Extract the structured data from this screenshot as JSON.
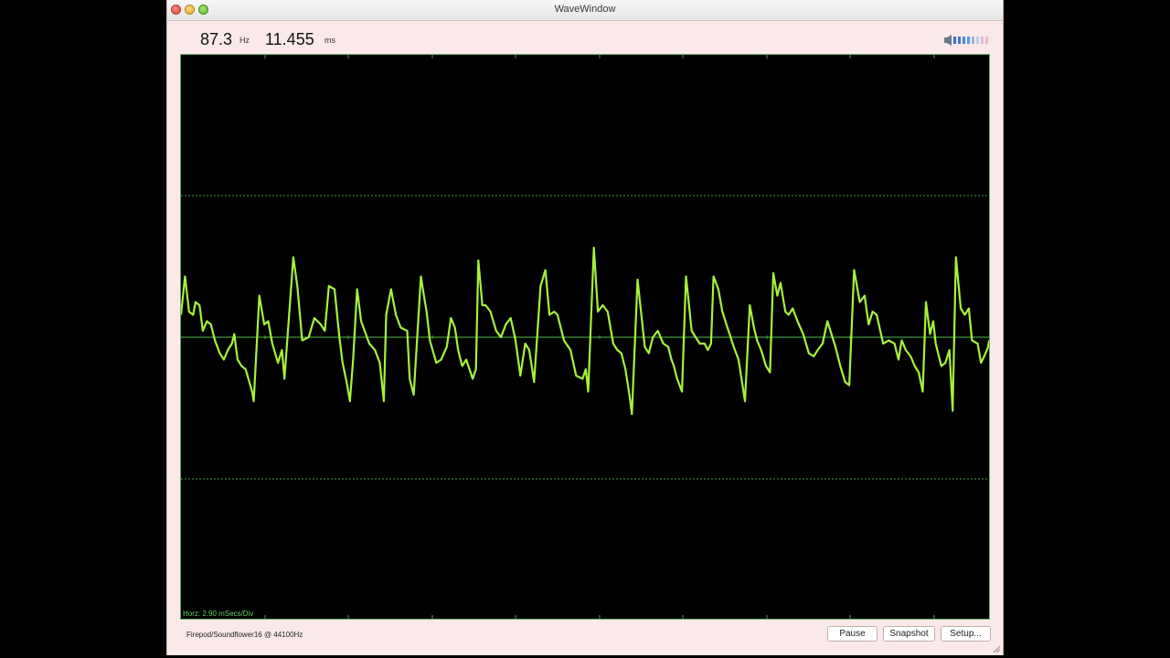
{
  "window": {
    "title": "WaveWindow"
  },
  "readout": {
    "frequency_value": "87.3",
    "frequency_unit": "Hz",
    "period_value": "11.455",
    "period_unit": "ms"
  },
  "scope": {
    "horizontal_scale": "Horz: 2.90 mSecs/Div",
    "trace_color": "#a6f23c",
    "grid_color": "#4f9a4f",
    "background_color": "#000000"
  },
  "status": {
    "device": "Firepod/Soundflower16 @ 44100Hz"
  },
  "buttons": {
    "pause": "Pause",
    "snapshot": "Snapshot",
    "setup": "Setup..."
  },
  "waveform": [
    [
      0.0,
      -0.35
    ],
    [
      0.005,
      -0.95
    ],
    [
      0.01,
      -0.4
    ],
    [
      0.015,
      -0.35
    ],
    [
      0.018,
      -0.55
    ],
    [
      0.023,
      -0.5
    ],
    [
      0.027,
      -0.1
    ],
    [
      0.032,
      -0.25
    ],
    [
      0.037,
      -0.2
    ],
    [
      0.042,
      0.05
    ],
    [
      0.048,
      0.25
    ],
    [
      0.053,
      0.35
    ],
    [
      0.058,
      0.2
    ],
    [
      0.063,
      0.1
    ],
    [
      0.066,
      -0.05
    ],
    [
      0.07,
      0.35
    ],
    [
      0.075,
      0.45
    ],
    [
      0.08,
      0.5
    ],
    [
      0.088,
      0.85
    ],
    [
      0.09,
      1.0
    ],
    [
      0.097,
      -0.65
    ],
    [
      0.103,
      -0.2
    ],
    [
      0.108,
      -0.25
    ],
    [
      0.113,
      0.1
    ],
    [
      0.12,
      0.4
    ],
    [
      0.125,
      0.2
    ],
    [
      0.128,
      0.65
    ],
    [
      0.139,
      -1.25
    ],
    [
      0.144,
      -0.8
    ],
    [
      0.15,
      0.05
    ],
    [
      0.158,
      0.0
    ],
    [
      0.165,
      -0.3
    ],
    [
      0.173,
      -0.2
    ],
    [
      0.178,
      -0.1
    ],
    [
      0.183,
      -0.8
    ],
    [
      0.19,
      -0.75
    ],
    [
      0.196,
      0.0
    ],
    [
      0.2,
      0.4
    ],
    [
      0.205,
      0.7
    ],
    [
      0.209,
      1.0
    ],
    [
      0.213,
      0.35
    ],
    [
      0.218,
      -0.75
    ],
    [
      0.223,
      -0.25
    ],
    [
      0.233,
      0.1
    ],
    [
      0.24,
      0.2
    ],
    [
      0.246,
      0.4
    ],
    [
      0.251,
      1.0
    ],
    [
      0.254,
      -0.35
    ],
    [
      0.26,
      -0.75
    ],
    [
      0.266,
      -0.35
    ],
    [
      0.272,
      -0.15
    ],
    [
      0.28,
      -0.1
    ],
    [
      0.283,
      0.65
    ],
    [
      0.288,
      0.9
    ],
    [
      0.297,
      -0.95
    ],
    [
      0.3,
      -0.7
    ],
    [
      0.304,
      -0.4
    ],
    [
      0.308,
      0.05
    ],
    [
      0.316,
      0.4
    ],
    [
      0.322,
      0.35
    ],
    [
      0.329,
      0.15
    ],
    [
      0.334,
      -0.3
    ],
    [
      0.339,
      -0.15
    ],
    [
      0.343,
      0.2
    ],
    [
      0.348,
      0.45
    ],
    [
      0.353,
      0.35
    ],
    [
      0.361,
      0.65
    ],
    [
      0.365,
      0.5
    ],
    [
      0.368,
      -1.2
    ],
    [
      0.373,
      -0.5
    ],
    [
      0.377,
      -0.5
    ],
    [
      0.383,
      -0.4
    ],
    [
      0.39,
      -0.1
    ],
    [
      0.396,
      0.0
    ],
    [
      0.402,
      -0.2
    ],
    [
      0.408,
      -0.3
    ],
    [
      0.414,
      0.05
    ],
    [
      0.42,
      0.6
    ],
    [
      0.426,
      0.1
    ],
    [
      0.431,
      0.2
    ],
    [
      0.437,
      0.7
    ],
    [
      0.445,
      -0.8
    ],
    [
      0.451,
      -1.05
    ],
    [
      0.456,
      -0.35
    ],
    [
      0.462,
      -0.4
    ],
    [
      0.466,
      -0.35
    ],
    [
      0.474,
      0.05
    ],
    [
      0.482,
      0.2
    ],
    [
      0.489,
      0.6
    ],
    [
      0.497,
      0.65
    ],
    [
      0.501,
      0.5
    ],
    [
      0.504,
      0.85
    ],
    [
      0.511,
      -1.4
    ],
    [
      0.516,
      -0.4
    ],
    [
      0.522,
      -0.5
    ],
    [
      0.528,
      -0.4
    ],
    [
      0.535,
      0.1
    ],
    [
      0.54,
      0.2
    ],
    [
      0.545,
      0.25
    ],
    [
      0.55,
      0.5
    ],
    [
      0.555,
      0.9
    ],
    [
      0.558,
      1.2
    ],
    [
      0.565,
      -0.9
    ],
    [
      0.574,
      0.15
    ],
    [
      0.579,
      0.25
    ],
    [
      0.584,
      0.0
    ],
    [
      0.59,
      -0.1
    ],
    [
      0.597,
      0.1
    ],
    [
      0.603,
      0.15
    ],
    [
      0.607,
      0.35
    ],
    [
      0.61,
      0.45
    ],
    [
      0.614,
      0.65
    ],
    [
      0.62,
      0.85
    ],
    [
      0.625,
      -0.95
    ],
    [
      0.632,
      -0.1
    ],
    [
      0.637,
      0.0
    ],
    [
      0.642,
      0.1
    ],
    [
      0.648,
      0.1
    ],
    [
      0.652,
      0.2
    ],
    [
      0.656,
      0.1
    ],
    [
      0.659,
      -0.95
    ],
    [
      0.665,
      -0.75
    ],
    [
      0.67,
      -0.4
    ],
    [
      0.675,
      -0.2
    ],
    [
      0.679,
      -0.05
    ],
    [
      0.684,
      0.15
    ],
    [
      0.69,
      0.35
    ],
    [
      0.698,
      1.0
    ],
    [
      0.704,
      -0.5
    ],
    [
      0.709,
      -0.15
    ],
    [
      0.713,
      0.05
    ],
    [
      0.718,
      0.2
    ],
    [
      0.724,
      0.45
    ],
    [
      0.729,
      0.55
    ],
    [
      0.733,
      -1.0
    ],
    [
      0.738,
      -0.65
    ],
    [
      0.742,
      -0.85
    ],
    [
      0.748,
      -0.4
    ],
    [
      0.752,
      -0.35
    ],
    [
      0.757,
      -0.45
    ],
    [
      0.763,
      -0.25
    ],
    [
      0.77,
      -0.05
    ],
    [
      0.777,
      0.25
    ],
    [
      0.783,
      0.3
    ],
    [
      0.788,
      0.2
    ],
    [
      0.794,
      0.1
    ],
    [
      0.8,
      -0.25
    ],
    [
      0.805,
      -0.05
    ],
    [
      0.81,
      0.15
    ],
    [
      0.816,
      0.45
    ],
    [
      0.822,
      0.7
    ],
    [
      0.827,
      0.75
    ],
    [
      0.833,
      -1.05
    ],
    [
      0.84,
      -0.55
    ],
    [
      0.846,
      -0.65
    ],
    [
      0.851,
      -0.2
    ],
    [
      0.856,
      -0.4
    ],
    [
      0.861,
      -0.35
    ],
    [
      0.869,
      0.1
    ],
    [
      0.876,
      0.05
    ],
    [
      0.883,
      0.1
    ],
    [
      0.888,
      0.35
    ],
    [
      0.892,
      0.05
    ],
    [
      0.897,
      0.2
    ],
    [
      0.903,
      0.3
    ],
    [
      0.908,
      0.45
    ],
    [
      0.913,
      0.55
    ],
    [
      0.918,
      0.85
    ],
    [
      0.922,
      -0.55
    ],
    [
      0.927,
      -0.05
    ],
    [
      0.931,
      -0.25
    ],
    [
      0.934,
      0.1
    ],
    [
      0.941,
      0.45
    ],
    [
      0.946,
      0.4
    ],
    [
      0.951,
      0.2
    ],
    [
      0.955,
      1.15
    ],
    [
      0.959,
      -1.25
    ],
    [
      0.965,
      -0.45
    ],
    [
      0.97,
      -0.35
    ],
    [
      0.975,
      -0.45
    ],
    [
      0.979,
      0.05
    ],
    [
      0.986,
      0.1
    ],
    [
      0.99,
      0.4
    ],
    [
      0.994,
      0.3
    ],
    [
      0.999,
      0.15
    ],
    [
      1.0,
      0.05
    ]
  ]
}
